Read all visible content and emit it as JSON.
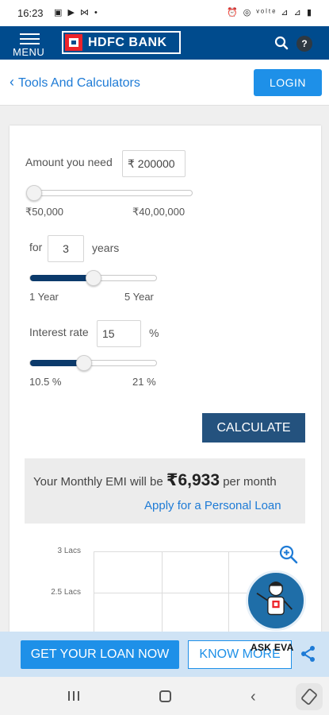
{
  "status_bar": {
    "time": "16:23",
    "left_icons": "▣ ▶ ⋈ •",
    "right_icons": "⏰ ◎ ᵛᵒˡᵗᵉ ⊿ ⊿ ▮"
  },
  "header": {
    "menu_label": "MENU",
    "brand_name": "HDFC BANK",
    "help_label": "?"
  },
  "subheader": {
    "back_label": "Tools And Calculators",
    "login_label": "LOGIN"
  },
  "calculator": {
    "amount": {
      "label": "Amount you need",
      "value": "₹ 200000",
      "min_label": "₹50,000",
      "max_label": "₹40,00,000",
      "slider_fraction": 0.04
    },
    "tenure": {
      "prefix": "for",
      "value": "3",
      "suffix": "years",
      "min_label": "1 Year",
      "max_label": "5 Year",
      "slider_fraction": 0.5
    },
    "interest": {
      "label": "Interest rate",
      "value": "15",
      "suffix": "%",
      "min_label": "10.5 %",
      "max_label": "21 %",
      "slider_fraction": 0.43
    },
    "calculate_label": "CALCULATE",
    "result": {
      "prefix": "Your Monthly EMI will be",
      "amount": "₹6,933",
      "suffix": "per month",
      "apply_label": "Apply for a Personal Loan"
    }
  },
  "chart": {
    "y_ticks": [
      "3 Lacs",
      "2.5 Lacs"
    ]
  },
  "assistant": {
    "label": "ASK EVA"
  },
  "loan_bar": {
    "get_loan_label": "GET YOUR LOAN NOW",
    "know_more_label": "KNOW MORE"
  },
  "colors": {
    "brand_blue": "#004b8d",
    "accent_blue": "#1e90e8",
    "slider_fill": "#0b3a6b",
    "calc_button": "#24527e",
    "brand_red": "#ed232a"
  }
}
